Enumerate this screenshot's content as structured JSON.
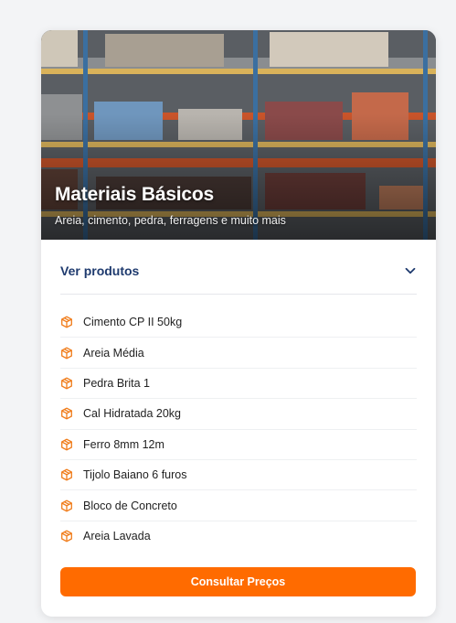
{
  "card": {
    "title": "Materiais Básicos",
    "subtitle": "Areia, cimento, pedra, ferragens e muito mais",
    "image_icon": "warehouse-shelves-photo"
  },
  "products": {
    "toggle_label": "Ver produtos",
    "toggle_icon": "chevron-down-icon",
    "item_icon": "package-icon",
    "items": [
      {
        "label": "Cimento CP II 50kg"
      },
      {
        "label": "Areia Média"
      },
      {
        "label": "Pedra Brita 1"
      },
      {
        "label": "Cal Hidratada 20kg"
      },
      {
        "label": "Ferro 8mm 12m"
      },
      {
        "label": "Tijolo Baiano 6 furos"
      },
      {
        "label": "Bloco de Concreto"
      },
      {
        "label": "Areia Lavada"
      }
    ]
  },
  "cta": {
    "label": "Consultar Preços"
  },
  "colors": {
    "accent": "#ff6b00",
    "link": "#1e3a6e",
    "icon": "#f07c1a",
    "rack_blue": "#3b6fa0",
    "rack_orange": "#d9692a"
  }
}
